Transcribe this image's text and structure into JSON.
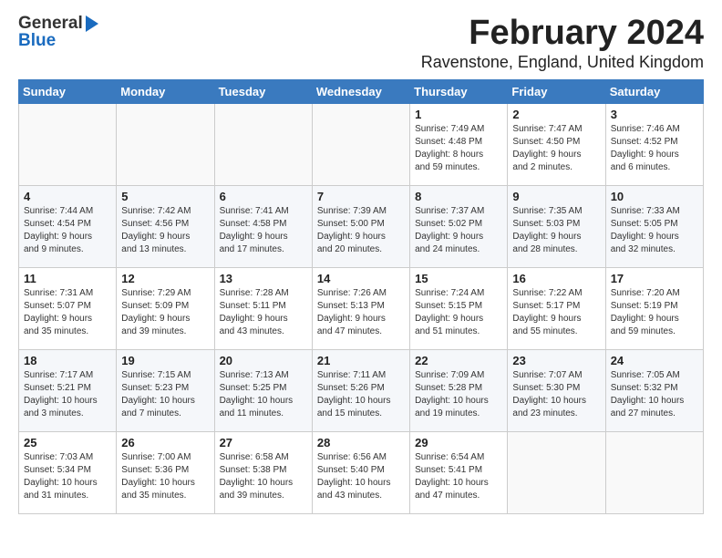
{
  "header": {
    "logo_general": "General",
    "logo_blue": "Blue",
    "month_year": "February 2024",
    "location": "Ravenstone, England, United Kingdom"
  },
  "weekdays": [
    "Sunday",
    "Monday",
    "Tuesday",
    "Wednesday",
    "Thursday",
    "Friday",
    "Saturday"
  ],
  "weeks": [
    [
      {
        "day": "",
        "info": ""
      },
      {
        "day": "",
        "info": ""
      },
      {
        "day": "",
        "info": ""
      },
      {
        "day": "",
        "info": ""
      },
      {
        "day": "1",
        "info": "Sunrise: 7:49 AM\nSunset: 4:48 PM\nDaylight: 8 hours\nand 59 minutes."
      },
      {
        "day": "2",
        "info": "Sunrise: 7:47 AM\nSunset: 4:50 PM\nDaylight: 9 hours\nand 2 minutes."
      },
      {
        "day": "3",
        "info": "Sunrise: 7:46 AM\nSunset: 4:52 PM\nDaylight: 9 hours\nand 6 minutes."
      }
    ],
    [
      {
        "day": "4",
        "info": "Sunrise: 7:44 AM\nSunset: 4:54 PM\nDaylight: 9 hours\nand 9 minutes."
      },
      {
        "day": "5",
        "info": "Sunrise: 7:42 AM\nSunset: 4:56 PM\nDaylight: 9 hours\nand 13 minutes."
      },
      {
        "day": "6",
        "info": "Sunrise: 7:41 AM\nSunset: 4:58 PM\nDaylight: 9 hours\nand 17 minutes."
      },
      {
        "day": "7",
        "info": "Sunrise: 7:39 AM\nSunset: 5:00 PM\nDaylight: 9 hours\nand 20 minutes."
      },
      {
        "day": "8",
        "info": "Sunrise: 7:37 AM\nSunset: 5:02 PM\nDaylight: 9 hours\nand 24 minutes."
      },
      {
        "day": "9",
        "info": "Sunrise: 7:35 AM\nSunset: 5:03 PM\nDaylight: 9 hours\nand 28 minutes."
      },
      {
        "day": "10",
        "info": "Sunrise: 7:33 AM\nSunset: 5:05 PM\nDaylight: 9 hours\nand 32 minutes."
      }
    ],
    [
      {
        "day": "11",
        "info": "Sunrise: 7:31 AM\nSunset: 5:07 PM\nDaylight: 9 hours\nand 35 minutes."
      },
      {
        "day": "12",
        "info": "Sunrise: 7:29 AM\nSunset: 5:09 PM\nDaylight: 9 hours\nand 39 minutes."
      },
      {
        "day": "13",
        "info": "Sunrise: 7:28 AM\nSunset: 5:11 PM\nDaylight: 9 hours\nand 43 minutes."
      },
      {
        "day": "14",
        "info": "Sunrise: 7:26 AM\nSunset: 5:13 PM\nDaylight: 9 hours\nand 47 minutes."
      },
      {
        "day": "15",
        "info": "Sunrise: 7:24 AM\nSunset: 5:15 PM\nDaylight: 9 hours\nand 51 minutes."
      },
      {
        "day": "16",
        "info": "Sunrise: 7:22 AM\nSunset: 5:17 PM\nDaylight: 9 hours\nand 55 minutes."
      },
      {
        "day": "17",
        "info": "Sunrise: 7:20 AM\nSunset: 5:19 PM\nDaylight: 9 hours\nand 59 minutes."
      }
    ],
    [
      {
        "day": "18",
        "info": "Sunrise: 7:17 AM\nSunset: 5:21 PM\nDaylight: 10 hours\nand 3 minutes."
      },
      {
        "day": "19",
        "info": "Sunrise: 7:15 AM\nSunset: 5:23 PM\nDaylight: 10 hours\nand 7 minutes."
      },
      {
        "day": "20",
        "info": "Sunrise: 7:13 AM\nSunset: 5:25 PM\nDaylight: 10 hours\nand 11 minutes."
      },
      {
        "day": "21",
        "info": "Sunrise: 7:11 AM\nSunset: 5:26 PM\nDaylight: 10 hours\nand 15 minutes."
      },
      {
        "day": "22",
        "info": "Sunrise: 7:09 AM\nSunset: 5:28 PM\nDaylight: 10 hours\nand 19 minutes."
      },
      {
        "day": "23",
        "info": "Sunrise: 7:07 AM\nSunset: 5:30 PM\nDaylight: 10 hours\nand 23 minutes."
      },
      {
        "day": "24",
        "info": "Sunrise: 7:05 AM\nSunset: 5:32 PM\nDaylight: 10 hours\nand 27 minutes."
      }
    ],
    [
      {
        "day": "25",
        "info": "Sunrise: 7:03 AM\nSunset: 5:34 PM\nDaylight: 10 hours\nand 31 minutes."
      },
      {
        "day": "26",
        "info": "Sunrise: 7:00 AM\nSunset: 5:36 PM\nDaylight: 10 hours\nand 35 minutes."
      },
      {
        "day": "27",
        "info": "Sunrise: 6:58 AM\nSunset: 5:38 PM\nDaylight: 10 hours\nand 39 minutes."
      },
      {
        "day": "28",
        "info": "Sunrise: 6:56 AM\nSunset: 5:40 PM\nDaylight: 10 hours\nand 43 minutes."
      },
      {
        "day": "29",
        "info": "Sunrise: 6:54 AM\nSunset: 5:41 PM\nDaylight: 10 hours\nand 47 minutes."
      },
      {
        "day": "",
        "info": ""
      },
      {
        "day": "",
        "info": ""
      }
    ]
  ]
}
